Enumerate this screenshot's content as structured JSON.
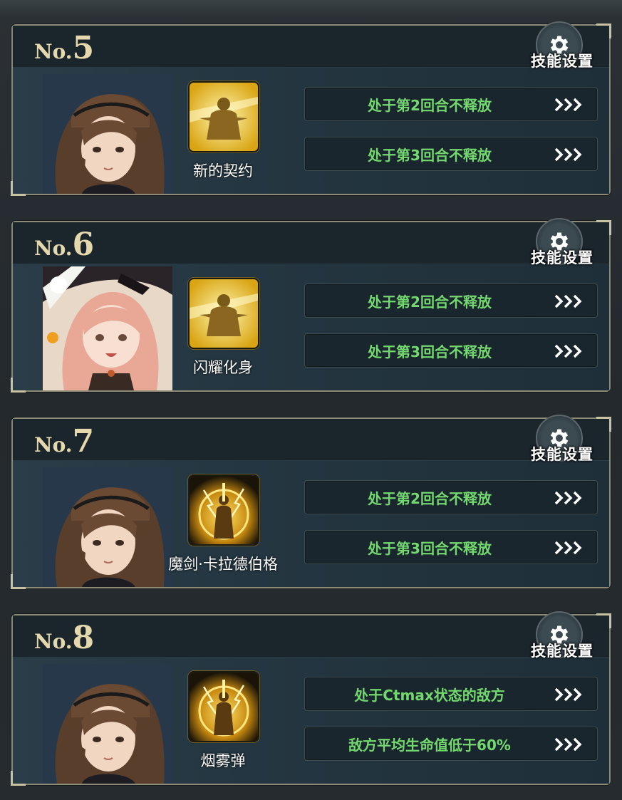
{
  "colors": {
    "condition_text": "#73d86e",
    "number_label": "#e6d8ad",
    "card_border": "#8d8a75",
    "panel_bg": "#1f2b33"
  },
  "cards": [
    {
      "prefix": "No.",
      "number": "5",
      "settings_label": "技能设置",
      "skill_name": "新的契约",
      "portrait": "brown-hair-character",
      "skill_icon": "golden-figure-icon",
      "conditions": [
        "处于第2回合不释放",
        "处于第3回合不释放"
      ]
    },
    {
      "prefix": "No.",
      "number": "6",
      "settings_label": "技能设置",
      "skill_name": "闪耀化身",
      "portrait": "pink-hair-witch-character",
      "skill_icon": "golden-figure-icon",
      "conditions": [
        "处于第2回合不释放",
        "处于第3回合不释放"
      ]
    },
    {
      "prefix": "No.",
      "number": "7",
      "settings_label": "技能设置",
      "skill_name": "魔剑·卡拉德伯格",
      "portrait": "brown-hair-character",
      "skill_icon": "lightning-warrior-icon",
      "conditions": [
        "处于第2回合不释放",
        "处于第3回合不释放"
      ]
    },
    {
      "prefix": "No.",
      "number": "8",
      "settings_label": "技能设置",
      "skill_name": "烟雾弹",
      "portrait": "brown-hair-character",
      "skill_icon": "lightning-warrior-icon",
      "conditions": [
        "处于Ctmax状态的敌方",
        "敌方平均生命值低于60%"
      ]
    }
  ]
}
